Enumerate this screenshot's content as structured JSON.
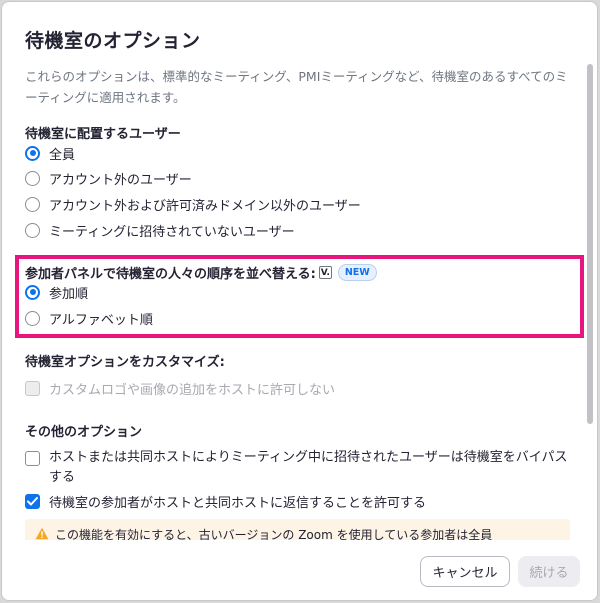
{
  "dialog": {
    "title": "待機室のオプション",
    "description": "これらのオプションは、標準的なミーティング、PMIミーティングなど、待機室のあるすべてのミーティングに適用されます。"
  },
  "who_section": {
    "title": "待機室に配置するユーザー",
    "options": [
      {
        "label": "全員",
        "checked": true
      },
      {
        "label": "アカウント外のユーザー",
        "checked": false
      },
      {
        "label": "アカウント外および許可済みドメイン以外のユーザー",
        "checked": false
      },
      {
        "label": "ミーティングに招待されていないユーザー",
        "checked": false
      }
    ]
  },
  "order_section": {
    "title": "参加者パネルで待機室の人々の順序を並べ替える:",
    "version_badge": "V.",
    "new_badge": "NEW",
    "options": [
      {
        "label": "参加順",
        "checked": true
      },
      {
        "label": "アルファベット順",
        "checked": false
      }
    ],
    "highlight_color": "#e8157f"
  },
  "customize_section": {
    "title": "待機室オプションをカスタマイズ:",
    "option": {
      "label": "カスタムロゴや画像の追加をホストに許可しない",
      "checked": false,
      "disabled": true
    }
  },
  "other_section": {
    "title": "その他のオプション",
    "options": [
      {
        "label": "ホストまたは共同ホストによりミーティング中に招待されたユーザーは待機室をバイパスする",
        "checked": false
      },
      {
        "label": "待機室の参加者がホストと共同ホストに返信することを許可する",
        "checked": true
      }
    ],
    "notice": "この機能を有効にすると、古いバージョンの Zoom を使用している参加者は全員"
  },
  "footer": {
    "cancel_label": "キャンセル",
    "continue_label": "続ける"
  },
  "colors": {
    "accent": "#0e72ed",
    "highlight": "#e8157f",
    "notice_bg": "#fdf4e6",
    "warning": "#f5a623"
  },
  "icons": {
    "warning": "warning-icon",
    "check": "check-icon"
  }
}
